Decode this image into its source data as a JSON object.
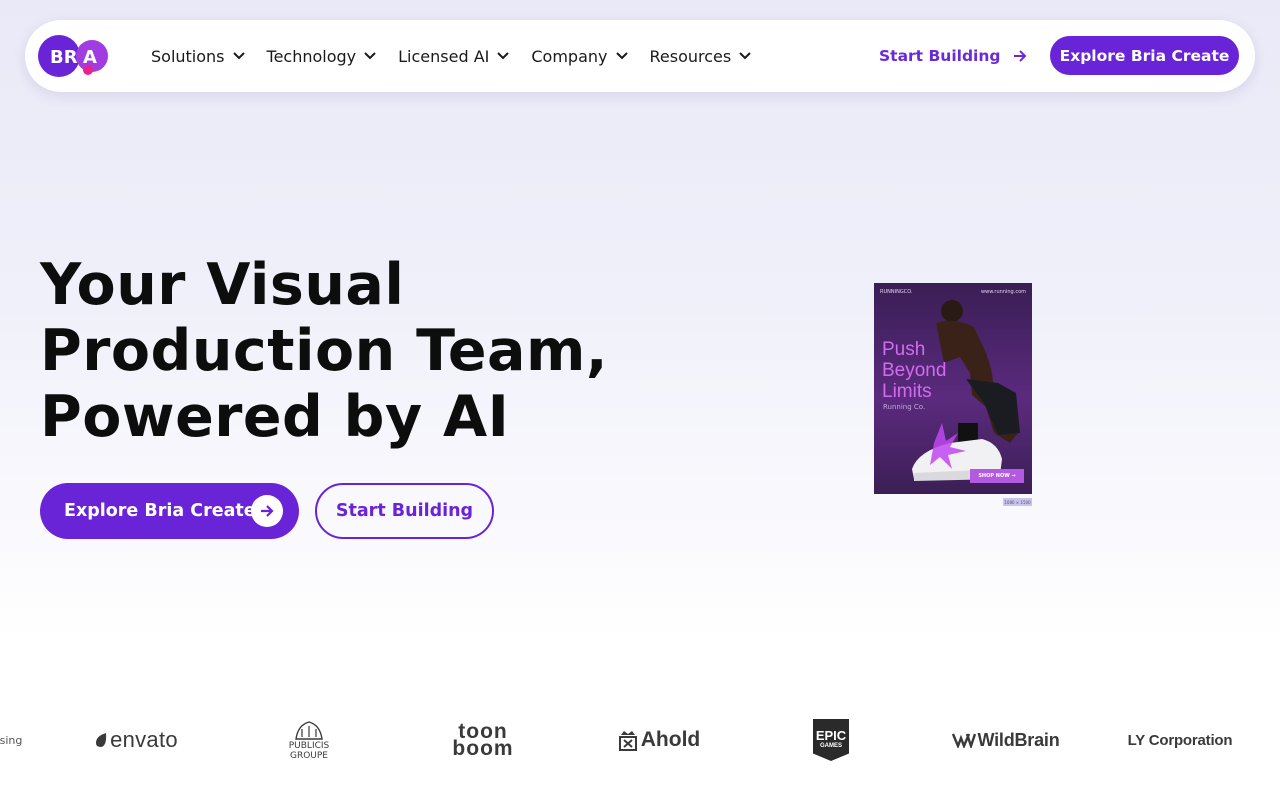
{
  "brand": {
    "name": "BRIA",
    "accent": "#6a24d8",
    "dot": "#e8248c"
  },
  "nav": {
    "items": [
      {
        "label": "Solutions"
      },
      {
        "label": "Technology"
      },
      {
        "label": "Licensed AI"
      },
      {
        "label": "Company"
      },
      {
        "label": "Resources"
      }
    ],
    "start_building": "Start Building",
    "explore": "Explore Bria Create"
  },
  "hero": {
    "title_lines": [
      "Your Visual",
      "Production Team,",
      "Powered by AI"
    ],
    "primary_cta": "Explore Bria Create",
    "secondary_cta": "Start Building"
  },
  "ad": {
    "brand": "RUNNINGCO.",
    "url": "www.running.com",
    "headline": "Push Beyond Limits",
    "subtitle": "Running Co.",
    "cta": "SHOP NOW →",
    "size_tag": "1080 × 1500"
  },
  "logos": {
    "partial": "sing",
    "envato": "envato",
    "publicis_line1": "PUBLICIS",
    "publicis_line2": "GROUPE",
    "toonboom_line1": "toon",
    "toonboom_line2": "boom",
    "ahold": "Ahold",
    "epic_line1": "EPIC",
    "epic_line2": "GAMES",
    "wildbrain": "WildBrain",
    "ly": "LY Corporation"
  }
}
